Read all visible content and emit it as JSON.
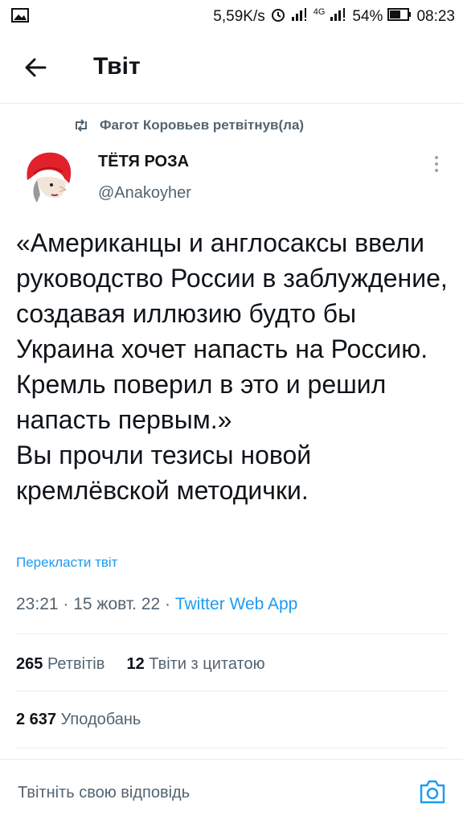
{
  "status_bar": {
    "speed": "5,59K/s",
    "battery": "54%",
    "time": "08:23",
    "network": "4G"
  },
  "header": {
    "title": "Твіт"
  },
  "retweet": {
    "text": "Фагот Коровьев ретвітнув(ла)"
  },
  "author": {
    "name": "ТЁТЯ РОЗА",
    "handle": "@Anakoyher"
  },
  "tweet": {
    "text": "«Американцы и англосаксы ввели руководство России в заблуждение, создавая иллюзию будто бы Украина хочет напасть на Россию. Кремль поверил в это и решил напасть первым.»\nВы прочли тезисы новой кремлёвской методички.",
    "translate": "Перекласти твіт",
    "time": "23:21",
    "date": "15 жовт. 22",
    "source": "Twitter Web App"
  },
  "stats": {
    "retweets_count": "265",
    "retweets_label": "Ретвітів",
    "quotes_count": "12",
    "quotes_label": "Твіти з цитатою",
    "likes_count": "2 637",
    "likes_label": "Уподобань"
  },
  "reply": {
    "placeholder": "Твітніть свою відповідь"
  },
  "colors": {
    "link": "#1d9bf0",
    "secondary_text": "#536471",
    "avatar_hat": "#e2222b"
  }
}
